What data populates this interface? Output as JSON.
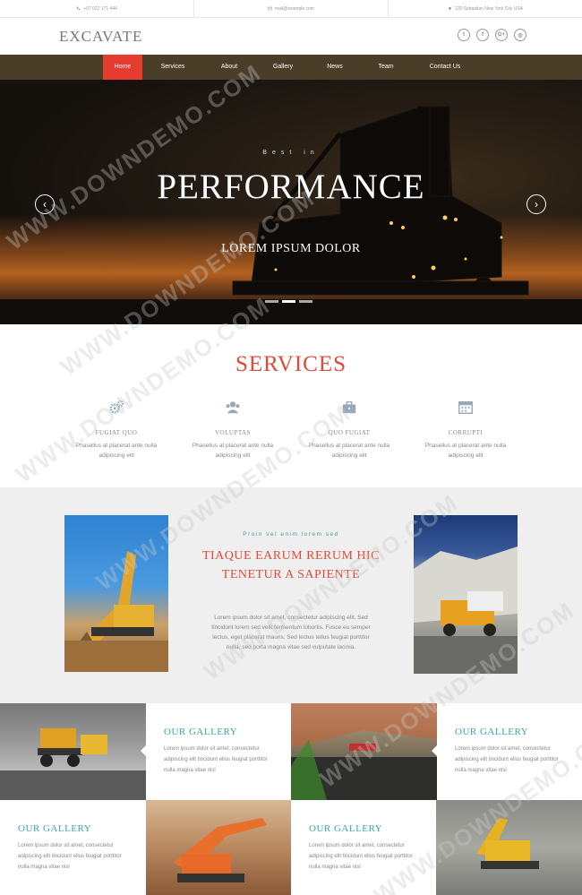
{
  "topbar": {
    "phone": "+07 022 171 444",
    "email": "mail@example.com",
    "address": "120 Sebastian New York City USA"
  },
  "brand": {
    "logo": "EXCAVATE"
  },
  "social": [
    "twitter-icon",
    "facebook-icon",
    "google-plus-icon",
    "dribbble-icon"
  ],
  "nav": {
    "items": [
      {
        "label": "Home",
        "active": true
      },
      {
        "label": "Services"
      },
      {
        "label": "About"
      },
      {
        "label": "Gallery"
      },
      {
        "label": "News"
      },
      {
        "label": "Team"
      },
      {
        "label": "Contact Us"
      }
    ]
  },
  "hero": {
    "kicker": "Best in",
    "title": "PERFORMANCE",
    "subtitle": "LOREM IPSUM DOLOR",
    "prev": "‹",
    "next": "›",
    "slides": 3,
    "active_slide": 2
  },
  "services": {
    "title": "SERVICES",
    "items": [
      {
        "icon": "gears-icon",
        "title": "FUGIAT QUO",
        "desc": "Phasellus at placerat ante nulla adipiscing elit"
      },
      {
        "icon": "users-icon",
        "title": "VOLUPTAS",
        "desc": "Phasellus at placerat ante nulla adipiscing elit"
      },
      {
        "icon": "briefcase-icon",
        "title": "QUO FUGIAT",
        "desc": "Phasellus at placerat ante nulla adipiscing elit"
      },
      {
        "icon": "calendar-icon",
        "title": "CORRUPTI",
        "desc": "Phasellus at placerat ante nulla adipiscing elit"
      }
    ]
  },
  "feature": {
    "kicker": "Proin vel enim lorem sed",
    "title": "TIAQUE EARUM RERUM HIC TENETUR A SAPIENTE",
    "text": "Lorem ipsum dolor sit amet, consectetur adipiscing elit. Sed tincidunt lorem sed velit fermentum lobortis. Fusce eu semper lectus, eget placerat mauris. Sed lectus tellus feugiat porttitor nulla, sed porta magna vitae sed vulputate lacinia."
  },
  "gallery": {
    "items": [
      {
        "title": "OUR GALLERY",
        "desc": "Lorem ipsum dolor sit amet, consectetur adipiscing elit tincidunt ellus feugiat porttitor nulla magna vitae nisl"
      },
      {
        "title": "OUR GALLERY",
        "desc": "Lorem ipsum dolor sit amet, consectetur adipiscing elit tincidunt ellus feugiat porttitor nulla magna vitae nisl"
      },
      {
        "title": "OUR GALLERY",
        "desc": "Lorem ipsum dolor sit amet, consectetur adipiscing elit tincidunt ellus feugiat porttitor nulla magna vitae nisl"
      },
      {
        "title": "OUR GALLERY",
        "desc": "Lorem ipsum dolor sit amet, consectetur adipiscing elit tincidunt ellus feugiat porttitor nulla magna vitae nisl"
      }
    ]
  },
  "watermark": "WWW.DOWNDEMO.COM",
  "colors": {
    "accent": "#e04a3a",
    "teal": "#3aa6a0",
    "nav": "#4a3e28",
    "nav_active": "#e63c30"
  }
}
